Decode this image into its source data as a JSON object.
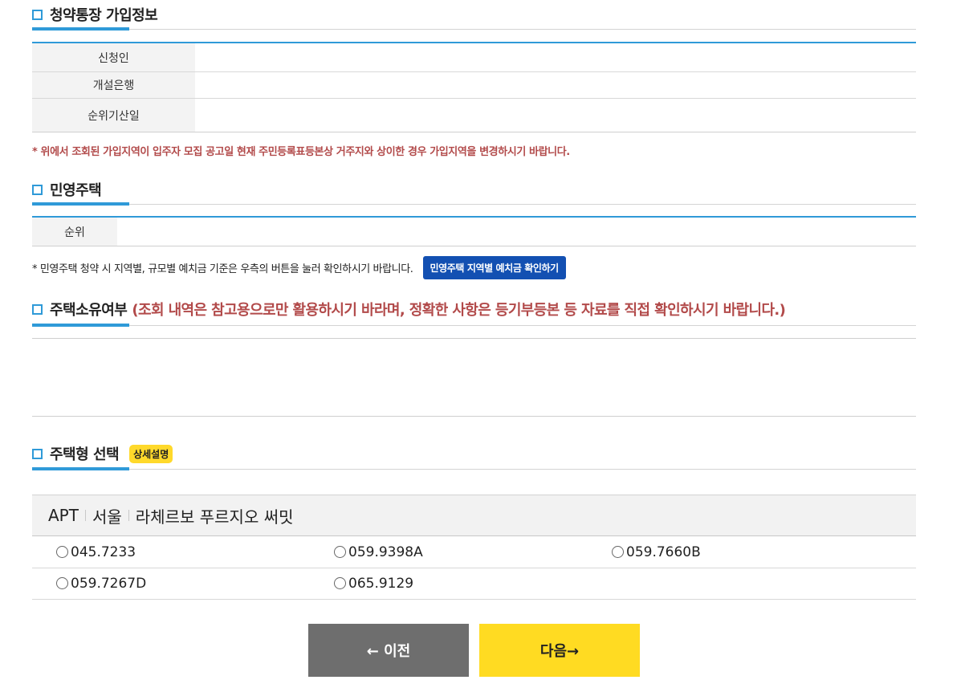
{
  "section_account": {
    "title": "청약통장 가입정보",
    "rows": [
      {
        "label": "신청인"
      },
      {
        "label": "개설은행"
      },
      {
        "label": "순위기산일"
      }
    ],
    "warning": "* 위에서 조회된 가입지역이 입주자 모집 공고일 현재 주민등록표등본상 거주지와 상이한 경우 가입지역을 변경하시기 바랍니다."
  },
  "section_private": {
    "title": "민영주택",
    "rows": [
      {
        "label": "순위"
      }
    ],
    "hint": "* 민영주택 청약 시 지역별, 규모별 예치금 기준은 우측의 버튼을 눌러 확인하시기 바랍니다.",
    "deposit_button": "민영주택 지역별 예치금 확인하기"
  },
  "section_ownership": {
    "title": "주택소유여부",
    "note": "(조회 내역은 참고용으로만 활용하시기 바라며, 정확한 사항은 등기부등본 등 자료를 직접 확인하시기 바랍니다.)"
  },
  "section_type": {
    "title": "주택형 선택",
    "detail_badge": "상세설명",
    "breadcrumb": [
      "APT",
      "서울",
      "라체르보 푸르지오 써밋"
    ],
    "options": [
      "045.7233",
      "059.9398A",
      "059.7660B",
      "059.7267D",
      "065.9129"
    ]
  },
  "nav": {
    "prev_label": "← 이전",
    "next_label": "다음→"
  },
  "colors": {
    "accent_blue": "#2f9ad8",
    "warning_red": "#b24a4a",
    "button_blue": "#1350b2",
    "badge_yellow": "#ffd92b",
    "next_yellow": "#ffdb22",
    "prev_gray": "#6e6e6e"
  }
}
